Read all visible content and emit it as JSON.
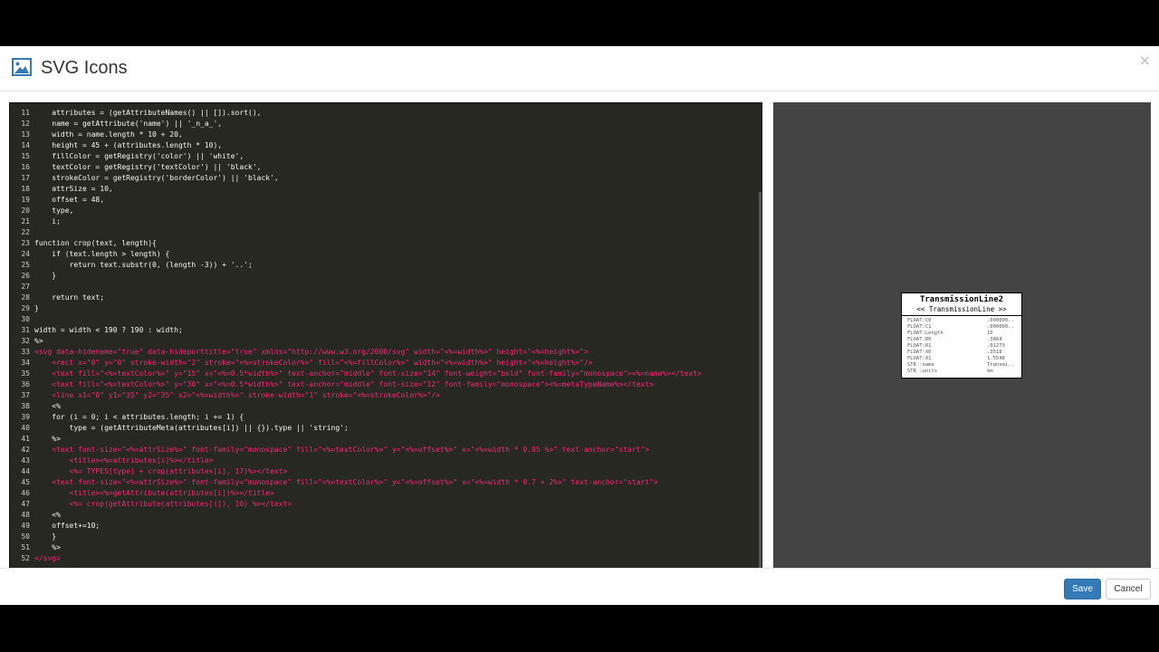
{
  "modal": {
    "title": "SVG Icons",
    "close_label": "×",
    "icon": "image-icon"
  },
  "editor": {
    "lines": [
      {
        "n": "11",
        "t": "    attributes = (getAttributeNames() || []).sort(),",
        "h": false
      },
      {
        "n": "12",
        "t": "    name = getAttribute('name') || '_n_a_',",
        "h": false
      },
      {
        "n": "13",
        "t": "    width = name.length * 10 + 20,",
        "h": false
      },
      {
        "n": "14",
        "t": "    height = 45 + (attributes.length * 10),",
        "h": false
      },
      {
        "n": "15",
        "t": "    fillColor = getRegistry('color') || 'white',",
        "h": false
      },
      {
        "n": "16",
        "t": "    textColor = getRegistry('textColor') || 'black',",
        "h": false
      },
      {
        "n": "17",
        "t": "    strokeColor = getRegistry('borderColor') || 'black',",
        "h": false
      },
      {
        "n": "18",
        "t": "    attrSize = 10,",
        "h": false
      },
      {
        "n": "19",
        "t": "    offset = 48,",
        "h": false
      },
      {
        "n": "20",
        "t": "    type,",
        "h": false
      },
      {
        "n": "21",
        "t": "    i;",
        "h": false
      },
      {
        "n": "22",
        "t": "",
        "h": false
      },
      {
        "n": "23",
        "t": "function crop(text, length){",
        "h": false
      },
      {
        "n": "24",
        "t": "    if (text.length > length) {",
        "h": false
      },
      {
        "n": "25",
        "t": "        return text.substr(0, (length -3)) + '..';",
        "h": false
      },
      {
        "n": "26",
        "t": "    }",
        "h": false
      },
      {
        "n": "27",
        "t": "",
        "h": false
      },
      {
        "n": "28",
        "t": "    return text;",
        "h": false
      },
      {
        "n": "29",
        "t": "}",
        "h": false
      },
      {
        "n": "30",
        "t": "",
        "h": false
      },
      {
        "n": "31",
        "t": "width = width < 190 ? 190 : width;",
        "h": false
      },
      {
        "n": "32",
        "t": "%>",
        "h": false
      },
      {
        "n": "33",
        "t": "<svg data-hidename=\"true\" data-hideporttitle=\"true\" xmlns=\"http://www.w3.org/2000/svg\" width=\"<%=width%>\" height=\"<%=height%>\">",
        "h": true
      },
      {
        "n": "34",
        "t": "    <rect x=\"0\" y=\"0\" stroke-width=\"2\" stroke=\"<%=strokeColor%>\" fill=\"<%=fillColor%>\" width=\"<%=width%>\" height=\"<%=height%>\"/>",
        "h": true
      },
      {
        "n": "35",
        "t": "    <text fill=\"<%=textColor%>\" y=\"15\" x=\"<%=0.5*width%>\" text-anchor=\"middle\" font-size=\"14\" font-weight=\"bold\" font-family=\"monospace\"><%=name%></text>",
        "h": true
      },
      {
        "n": "36",
        "t": "    <text fill=\"<%=textColor%>\" y=\"30\" x=\"<%=0.5*width%>\" text-anchor=\"middle\" font-size=\"12\" font-family=\"monospace\"><%=metaTypeName%></text>",
        "h": true
      },
      {
        "n": "37",
        "t": "    <line x1=\"0\" y1=\"35\" y2=\"35\" x2=\"<%=width%>\" stroke-width=\"1\" stroke=\"<%=strokeColor%>\"/>",
        "h": true
      },
      {
        "n": "38",
        "t": "    <%",
        "h": false
      },
      {
        "n": "39",
        "t": "    for (i = 0; i < attributes.length; i += 1) {",
        "h": false
      },
      {
        "n": "40",
        "t": "        type = (getAttributeMeta(attributes[i]) || {}).type || 'string';",
        "h": false
      },
      {
        "n": "41",
        "t": "    %>",
        "h": false
      },
      {
        "n": "42",
        "t": "    <text font-size=\"<%=attrSize%>\" font-family=\"monospace\" fill=\"<%=textColor%>\" y=\"<%=offset%>\" x=\"<%=width * 0.05 %>\" text-anchor=\"start\">",
        "h": true
      },
      {
        "n": "43",
        "t": "        <title><%=attributes[i]%></title>",
        "h": true
      },
      {
        "n": "44",
        "t": "        <%= TYPES[type] + crop(attributes[i], 17)%></text>",
        "h": true
      },
      {
        "n": "45",
        "t": "    <text font-size=\"<%=attrSize%>\" font-family=\"monospace\" fill=\"<%=textColor%>\" y=\"<%=offset%>\" x=\"<%=width * 0.7 + 2%>\" text-anchor=\"start\">",
        "h": true
      },
      {
        "n": "46",
        "t": "        <title><%=getAttribute(attributes[i])%></title>",
        "h": true
      },
      {
        "n": "47",
        "t": "        <%= crop(getAttribute(attributes[i]), 10) %></text>",
        "h": true
      },
      {
        "n": "48",
        "t": "    <%",
        "h": false
      },
      {
        "n": "49",
        "t": "    offset+=10;",
        "h": false
      },
      {
        "n": "50",
        "t": "    }",
        "h": false
      },
      {
        "n": "51",
        "t": "    %>",
        "h": false
      },
      {
        "n": "52",
        "t": "</svg>",
        "h": true
      }
    ]
  },
  "preview": {
    "node_name": "TransmissionLine2",
    "node_type": "<< TransmissionLine >>",
    "attributes": [
      {
        "name": "FLOAT:C0",
        "value": ".000000.."
      },
      {
        "name": "FLOAT:C1",
        "value": ".000000.."
      },
      {
        "name": "FLOAT:Length",
        "value": "10"
      },
      {
        "name": "FLOAT:R0",
        "value": ".3864"
      },
      {
        "name": "FLOAT:R1",
        "value": ".01273"
      },
      {
        "name": "FLOAT:X0",
        "value": ".3518"
      },
      {
        "name": "FLOAT:X1",
        "value": "1.5548"
      },
      {
        "name": "STR :name",
        "value": "Transmi.."
      },
      {
        "name": "STR :units",
        "value": "km"
      }
    ]
  },
  "footer": {
    "save_label": "Save",
    "cancel_label": "Cancel"
  },
  "colors": {
    "editor_bg": "#272822",
    "tag": "#f92672",
    "attribute": "#a6e22e",
    "preview_bg": "#444444",
    "primary": "#337ab7"
  }
}
